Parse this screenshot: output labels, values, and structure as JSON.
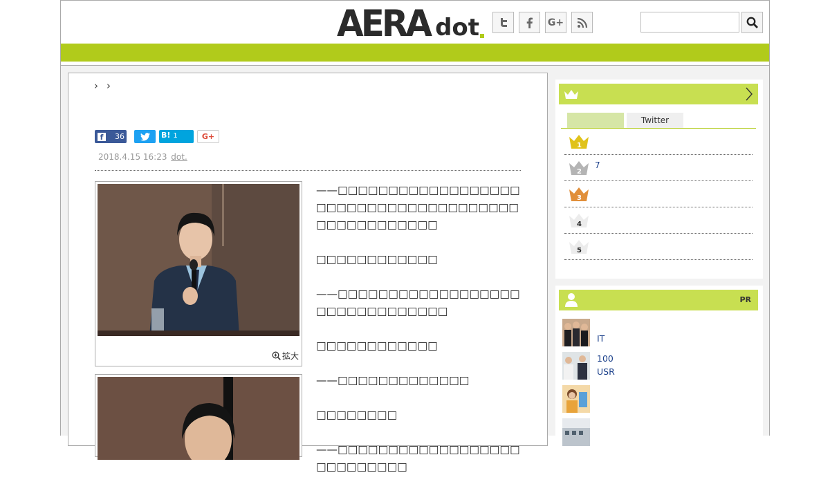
{
  "header": {
    "logo_main": "AERA",
    "logo_sub": "dot",
    "social": [
      {
        "icon": "twitter-icon",
        "glyph": "t"
      },
      {
        "icon": "facebook-icon",
        "glyph": "f"
      },
      {
        "icon": "google-plus-icon",
        "glyph": "G+"
      },
      {
        "icon": "rss-icon",
        "glyph": "rss"
      }
    ],
    "search_placeholder": ""
  },
  "colors": {
    "brand_green": "#b1cb1b",
    "panel_green": "#c8df51",
    "link_blue": "#1a3f8a"
  },
  "article": {
    "breadcrumb_sep": "›",
    "share": {
      "facebook_count": "36",
      "hatena_label": "B!",
      "hatena_count": "1",
      "gplus_label": "G+"
    },
    "date": "2018.4.15 16:23",
    "source": "dot.",
    "zoom_label": "拡大",
    "paragraphs": [
      "——□□□□□□□□□□□□□□□□□□□□□□□□□□□□□□□□□□□□□□□□□□□□□□□□□□",
      "□□□□□□□□□□□□",
      "——□□□□□□□□□□□□□□□□□□□□□□□□□□□□□□□",
      "□□□□□□□□□□□□",
      "——□□□□□□□□□□□□□",
      "□□□□□□□□",
      "——□□□□□□□□□□□□□□□□□□□□□□□□□□□"
    ]
  },
  "ranking": {
    "tabs": [
      "",
      "Twitter"
    ],
    "items": [
      {
        "rank": "1",
        "text": ""
      },
      {
        "rank": "2",
        "text": "7"
      },
      {
        "rank": "3",
        "text": ""
      },
      {
        "rank": "4",
        "text": ""
      },
      {
        "rank": "5",
        "text": ""
      }
    ]
  },
  "pr": {
    "label": "PR",
    "items": [
      {
        "lines": [
          "",
          "IT"
        ]
      },
      {
        "lines": [
          "100",
          "USR"
        ]
      },
      {
        "lines": [
          ""
        ]
      },
      {
        "lines": [
          ""
        ]
      }
    ]
  }
}
